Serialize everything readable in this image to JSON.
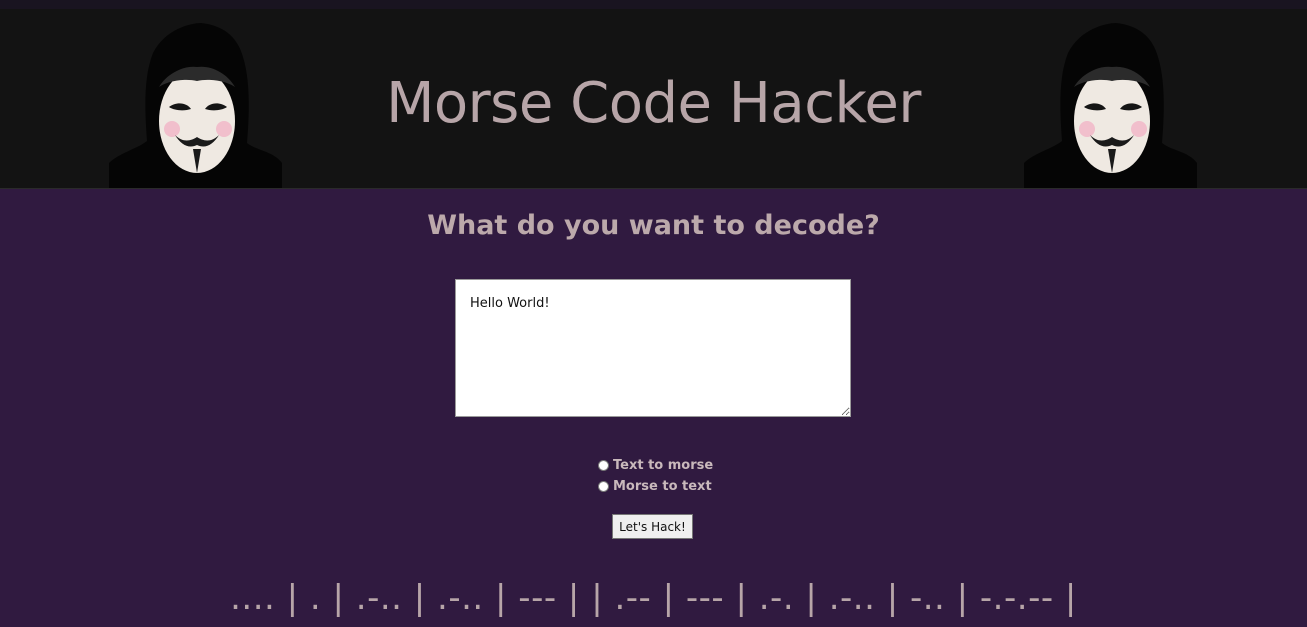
{
  "header": {
    "title": "Morse Code Hacker",
    "avatar_icon": "anonymous-mask-icon"
  },
  "main": {
    "question": "What do you want to decode?",
    "input_value": "Hello World!",
    "options": [
      {
        "label": "Text to morse",
        "checked": false
      },
      {
        "label": "Morse to text",
        "checked": false
      }
    ],
    "submit_label": "Let's Hack!",
    "output": ".... | . | .-.. | .-.. | --- | | .-- | --- | .-. | .-.. | -.. | -.-.-- |"
  },
  "colors": {
    "page_bg": "#301a40",
    "header_bg": "#131313",
    "title_text": "#b7a5a8"
  }
}
